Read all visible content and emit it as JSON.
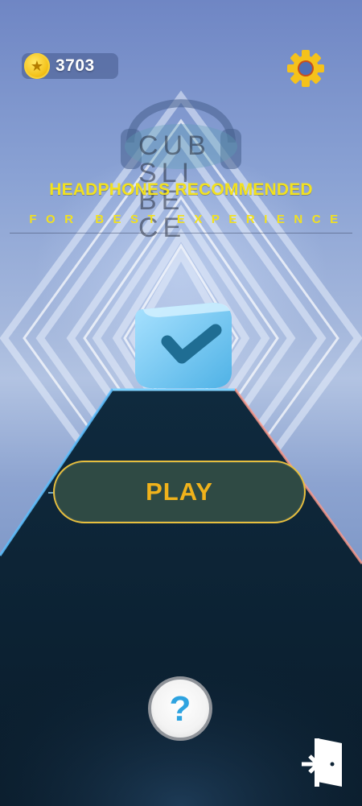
{
  "hud": {
    "coins": "3703",
    "coin_icon": "star-coin-icon",
    "settings_icon": "gear-icon"
  },
  "logo": {
    "text": "CUB\nSLI\nBE\nCE"
  },
  "banner": {
    "headline": "HEADPHONES RECOMMENDED",
    "subline": "FOR BEST EXPERIENCE"
  },
  "play_button": {
    "label": "PLAY"
  },
  "help_button": {
    "label": "?",
    "icon": "question-icon"
  },
  "exit_button": {
    "icon": "exit-door-icon"
  },
  "colors": {
    "accent_yellow": "#f2e11f",
    "play_text": "#f0b21b",
    "play_fill": "#2f4a44",
    "cube_blue": "#6ec4f0",
    "check_color": "#1f6d93"
  }
}
